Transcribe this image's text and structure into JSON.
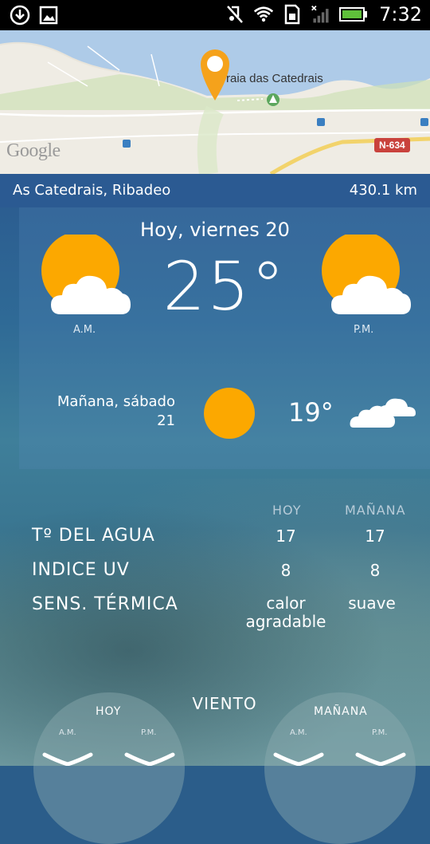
{
  "statusbar": {
    "time": "7:32",
    "icons": [
      "download-icon",
      "image-icon",
      "mute-icon",
      "wifi-icon",
      "sim-icon",
      "signal-icon",
      "battery-icon"
    ]
  },
  "map": {
    "place_label": "raia das Catedrais",
    "road_label": "N-634",
    "provider_logo": "Google"
  },
  "location": {
    "name": "As Catedrais, Ribadeo",
    "distance": "430.1 km"
  },
  "today": {
    "title": "Hoy, viernes 20",
    "temperature": "25°",
    "am_label": "A.M.",
    "pm_label": "P.M.",
    "am_icon": "sun-cloud-icon",
    "pm_icon": "sun-cloud-icon"
  },
  "tomorrow": {
    "title_line1": "Mañana, sábado",
    "title_line2": "21",
    "temperature": "19°",
    "icon": "sun-icon",
    "extra_icon": "clouds-icon"
  },
  "table": {
    "col_today": "HOY",
    "col_tomorrow": "MAÑANA",
    "rows": [
      {
        "label": "Tº DEL AGUA",
        "today": "17",
        "tomorrow": "17"
      },
      {
        "label": "INDICE UV",
        "today": "8",
        "tomorrow": "8"
      },
      {
        "label": "SENS. TÉRMICA",
        "today_line1": "calor",
        "today_line2": "agradable",
        "tomorrow": "suave"
      }
    ]
  },
  "wind": {
    "title": "VIENTO",
    "today_label": "HOY",
    "tomorrow_label": "MAÑANA",
    "am": "A.M.",
    "pm": "P.M."
  },
  "colors": {
    "sun": "#fca800",
    "location_bar": "#2b5a92",
    "road_badge": "#c9423c",
    "pin": "#f5a21b"
  }
}
